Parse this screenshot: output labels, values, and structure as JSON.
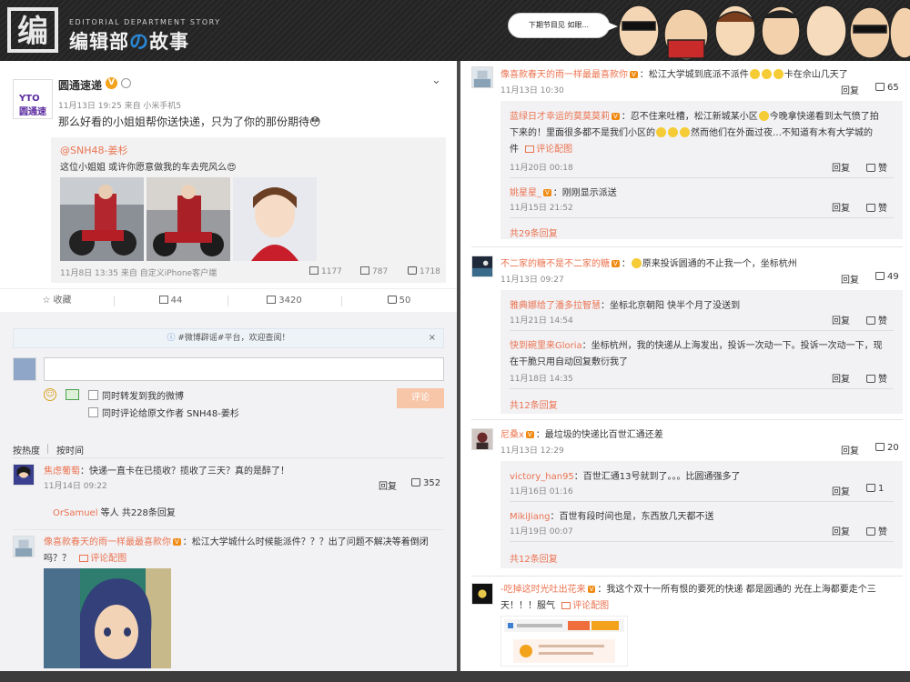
{
  "banner": {
    "logo_mark": "编",
    "logo_en": "EDITORIAL DEPARTMENT STORY",
    "logo_cn_a": "编辑部",
    "logo_cn_o": "の",
    "logo_cn_b": "故事",
    "bubble": "下期节目见 如眼..."
  },
  "post": {
    "avatar_text": "YTO 圆通速递",
    "name": "圆通速递",
    "meta": "11月13日 19:25 来自 小米手机5",
    "text": "那么好看的小姐姐帮你送快递，只为了你的那份期待😳",
    "repost": {
      "user": "@SNH48-姜杉",
      "text": "这位小姐姐 或许你愿意做我的车去兜风么😍",
      "meta": "11月8日 13:35 来自 自定义iPhone客户端",
      "reposts": "1177",
      "comments": "787",
      "likes": "1718"
    }
  },
  "actions": {
    "fav": "收藏",
    "repost": "44",
    "comment": "3420",
    "like": "50"
  },
  "notice": {
    "text": "#微博辟谣#平台，欢迎查阅！",
    "close": "×"
  },
  "composer": {
    "check1": "同时转发到我的微博",
    "check2": "同时评论给原文作者 SNH48-姜杉",
    "submit": "评论"
  },
  "sort": {
    "hot": "按热度",
    "time": "按时间"
  },
  "left_comments": [
    {
      "user": "焦虑葡萄",
      "text": "快递一直卡在已揽收？揽收了三天？真的是醉了！",
      "time": "11月14日 09:22",
      "reply": "回复",
      "likes": "352",
      "more_user": "OrSamuel",
      "more_text": "等人 共228条回复"
    },
    {
      "user": "像喜款春天的雨一样最最喜款你",
      "text_l1": "松江大学城什么时候能派件？？？出了问题不解决等着倒闭",
      "text_l2": "吗？？",
      "pic": "评论配图"
    }
  ],
  "right": {
    "c1": {
      "user": "像喜款春天的雨一样最最喜款你",
      "text": "松江大学城到底派不派件",
      "text_b": "卡在佘山几天了",
      "time": "11月13日 10:30",
      "reply": "回复",
      "likes": "65",
      "subs": [
        {
          "user": "蓝绿日才幸运的莫莫莫莉",
          "text_l1": "忍不住来吐槽，松江新城某小区",
          "text_l1b": "今晚拿快递看到太气愤了拍",
          "text_l2": "下来的！里面很多都不是我们小区的",
          "text_l2b": "然而他们在外面过夜…不知道有木有大学城的",
          "text_l3": "件",
          "pic": "评论配图",
          "time": "11月20日 00:18",
          "reply": "回复",
          "like": "赞"
        },
        {
          "user": "姚星星_",
          "text": "刚刚显示派送",
          "time": "11月15日 21:52",
          "reply": "回复",
          "like": "赞"
        }
      ],
      "more": "共29条回复"
    },
    "c2": {
      "user": "不二家的糖不是不二家的糖",
      "text": "原来投诉圆通的不止我一个，坐标杭州",
      "time": "11月13日 09:27",
      "reply": "回复",
      "likes": "49",
      "subs": [
        {
          "user": "雅典娜给了潘多拉智慧",
          "text": "坐标北京朝阳 快半个月了没送到",
          "time": "11月21日 14:54",
          "reply": "回复",
          "like": "赞"
        },
        {
          "user": "快到碗里来Gloria",
          "text_l1": "坐标杭州，我的快递从上海发出，投诉一次动一下。投诉一次动一下，现",
          "text_l2": "在干脆只用自动回复敷衍我了",
          "time": "11月18日 14:35",
          "reply": "回复",
          "like": "赞"
        }
      ],
      "more": "共12条回复"
    },
    "c3": {
      "user": "尼桑x",
      "text": "最垃圾的快递比百世汇通还差",
      "time": "11月13日 12:29",
      "reply": "回复",
      "likes": "20",
      "subs": [
        {
          "user": "victory_han95",
          "text": "百世汇通13号就到了。。。比圆通强多了",
          "time": "11月16日 01:16",
          "reply": "回复",
          "likes": "1"
        },
        {
          "user": "MikiJiang",
          "text": "百世有段时间也是，东西放几天都不送",
          "time": "11月19日 00:07",
          "reply": "回复",
          "like": "赞"
        }
      ],
      "more": "共12条回复"
    },
    "c4": {
      "user": "-吃掉这时光吐出花来",
      "text_l1": "我这个双十一所有恨的要死的快递 都是圆通的 光在上海都要走个三",
      "text_l2a": "天！！！服气",
      "pic": "评论配图"
    }
  },
  "colors": {
    "orange_link": "#eb7350",
    "vip": "#f08a12",
    "banner_bg": "#2c2c2c"
  }
}
